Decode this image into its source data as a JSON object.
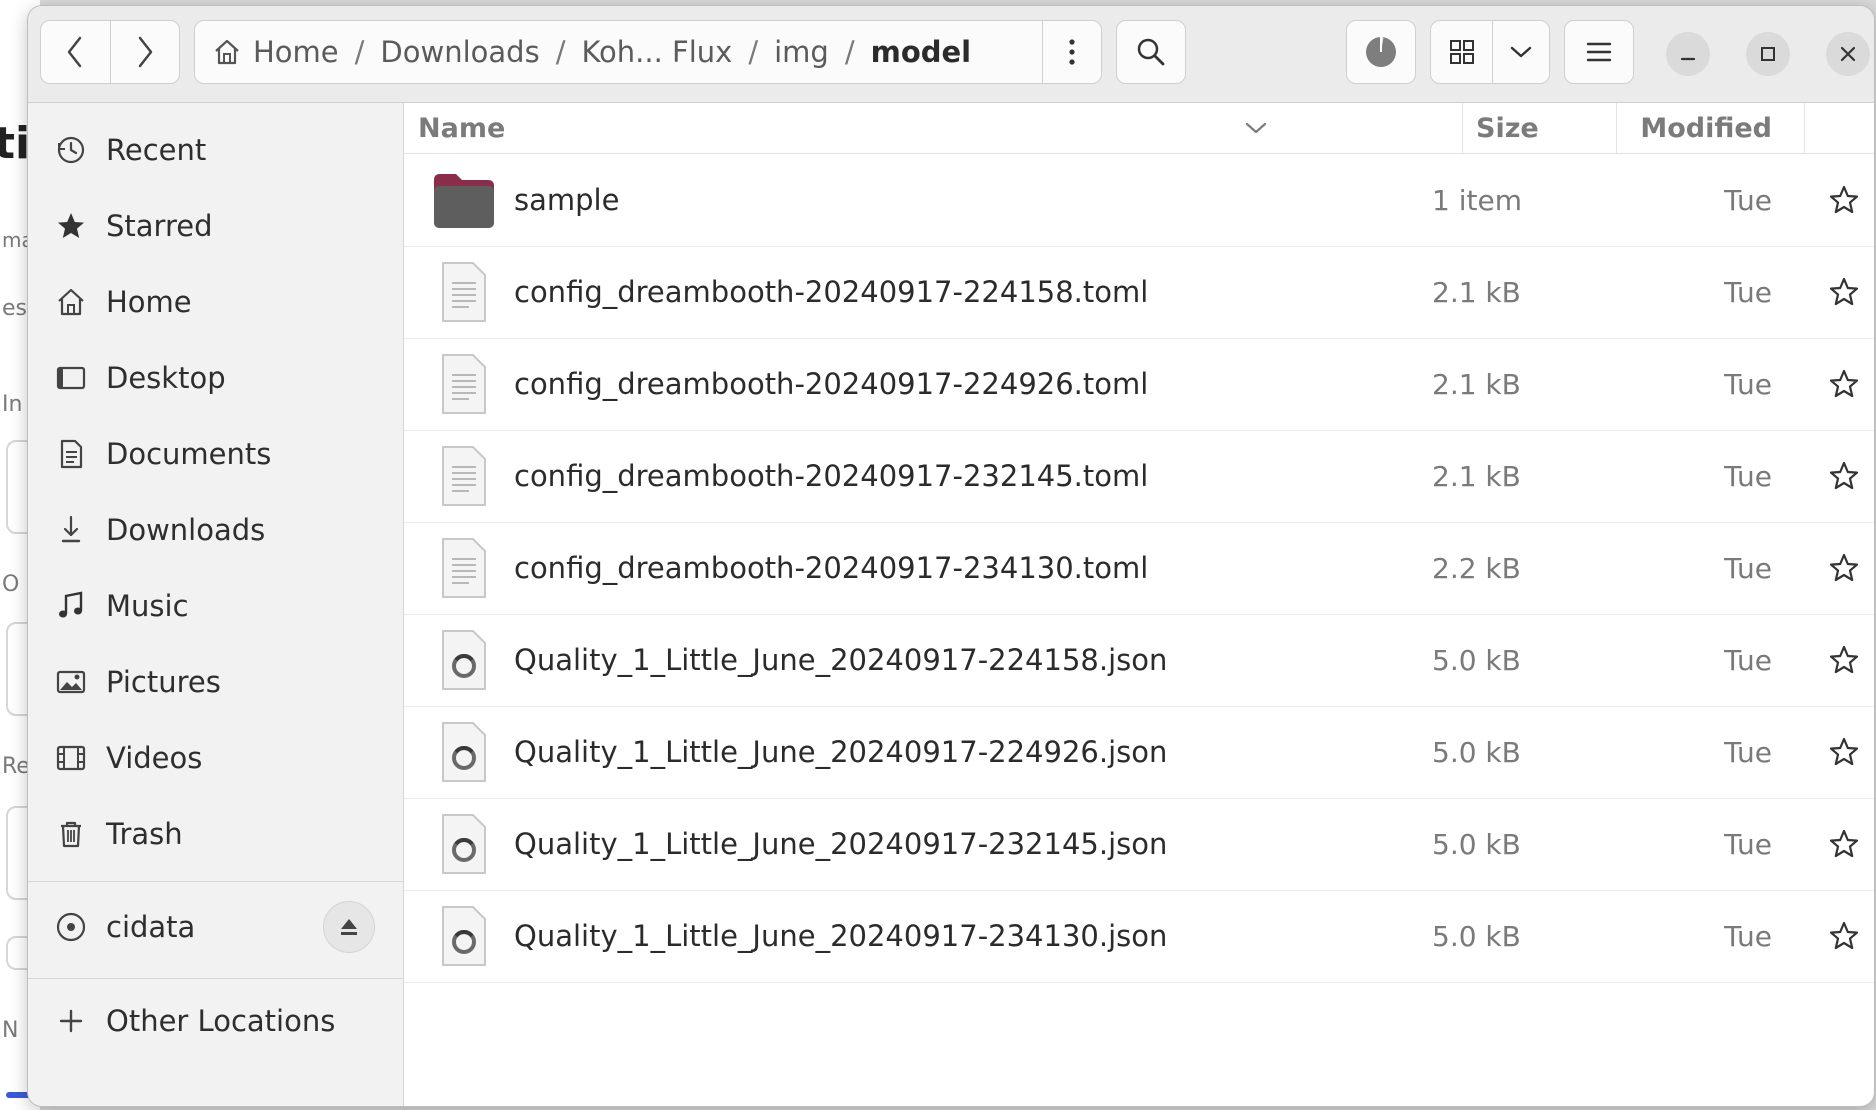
{
  "background_app": {
    "fragments": [
      "ti",
      "ma",
      "esi",
      "In",
      "O",
      "Re",
      "N"
    ]
  },
  "headerbar": {
    "back_icon": "chevron-left-icon",
    "forward_icon": "chevron-right-icon",
    "path": {
      "home_icon": "home-icon",
      "crumbs": [
        "Home",
        "Downloads",
        "Koh... Flux",
        "img",
        "model"
      ],
      "separator": "/"
    },
    "path_menu_icon": "vertical-dots-icon",
    "search_icon": "search-icon",
    "operations_icon": "pie-progress-icon",
    "view_icon": "grid-view-icon",
    "view_menu_icon": "chevron-down-icon",
    "main_menu_icon": "hamburger-menu-icon",
    "minimize_icon": "minimize-icon",
    "maximize_icon": "maximize-icon",
    "close_icon": "close-icon"
  },
  "sidebar": {
    "items": [
      {
        "label": "Recent",
        "icon": "clock-icon"
      },
      {
        "label": "Starred",
        "icon": "star-icon"
      },
      {
        "label": "Home",
        "icon": "home-icon"
      },
      {
        "label": "Desktop",
        "icon": "desktop-icon"
      },
      {
        "label": "Documents",
        "icon": "document-icon"
      },
      {
        "label": "Downloads",
        "icon": "download-icon"
      },
      {
        "label": "Music",
        "icon": "music-icon"
      },
      {
        "label": "Pictures",
        "icon": "picture-icon"
      },
      {
        "label": "Videos",
        "icon": "video-icon"
      },
      {
        "label": "Trash",
        "icon": "trash-icon"
      }
    ],
    "devices": [
      {
        "label": "cidata",
        "icon": "disc-icon",
        "eject_icon": "eject-icon"
      }
    ],
    "other_locations": {
      "label": "Other Locations",
      "icon": "plus-icon"
    }
  },
  "columns": {
    "name": "Name",
    "size": "Size",
    "modified": "Modified",
    "sort_icon": "chevron-down-icon"
  },
  "files": [
    {
      "name": "sample",
      "size": "1 item",
      "modified": "Tue",
      "type": "folder"
    },
    {
      "name": "config_dreambooth-20240917-224158.toml",
      "size": "2.1 kB",
      "modified": "Tue",
      "type": "text"
    },
    {
      "name": "config_dreambooth-20240917-224926.toml",
      "size": "2.1 kB",
      "modified": "Tue",
      "type": "text"
    },
    {
      "name": "config_dreambooth-20240917-232145.toml",
      "size": "2.1 kB",
      "modified": "Tue",
      "type": "text"
    },
    {
      "name": "config_dreambooth-20240917-234130.toml",
      "size": "2.2 kB",
      "modified": "Tue",
      "type": "text"
    },
    {
      "name": "Quality_1_Little_June_20240917-224158.json",
      "size": "5.0 kB",
      "modified": "Tue",
      "type": "json"
    },
    {
      "name": "Quality_1_Little_June_20240917-224926.json",
      "size": "5.0 kB",
      "modified": "Tue",
      "type": "json"
    },
    {
      "name": "Quality_1_Little_June_20240917-232145.json",
      "size": "5.0 kB",
      "modified": "Tue",
      "type": "json"
    },
    {
      "name": "Quality_1_Little_June_20240917-234130.json",
      "size": "5.0 kB",
      "modified": "Tue",
      "type": "json"
    }
  ],
  "colors": {
    "folder_tab": "#8a2d4a",
    "folder_body": "#5e5e5e",
    "accent_bar": "#3a5bd9"
  }
}
